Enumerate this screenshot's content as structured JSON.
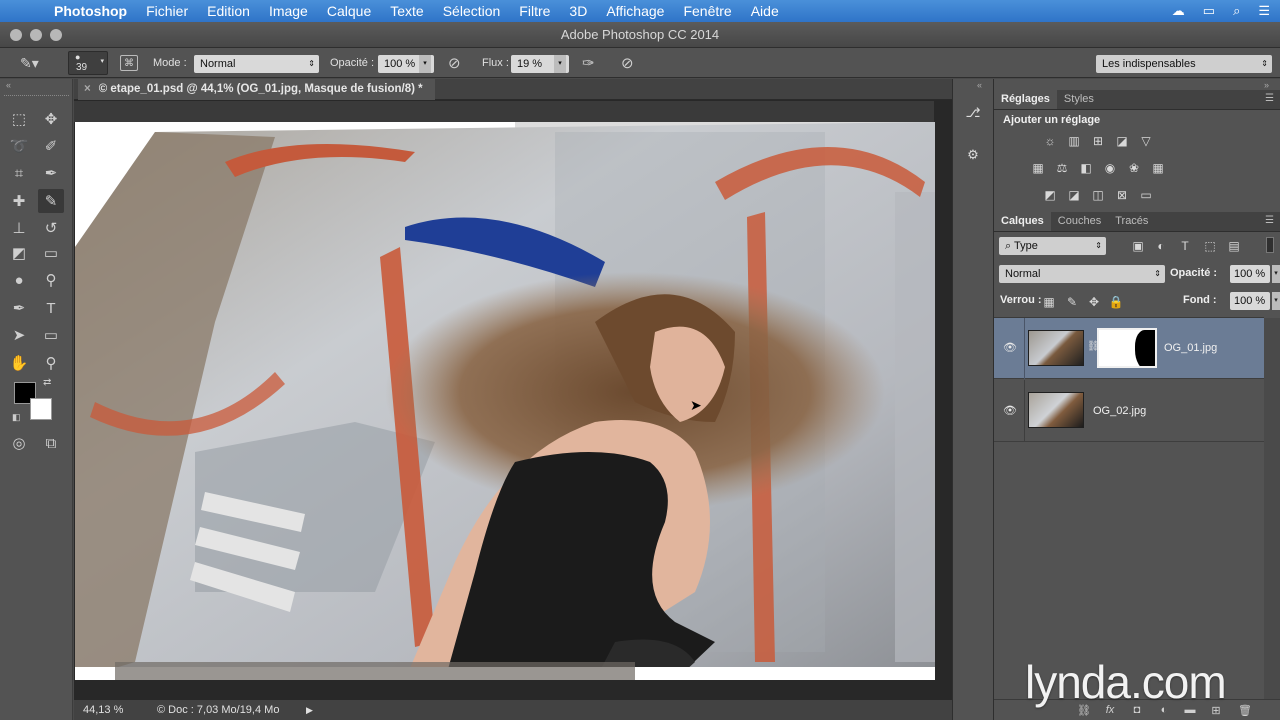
{
  "menubar": {
    "app": "Photoshop",
    "items": [
      "Fichier",
      "Edition",
      "Image",
      "Calque",
      "Texte",
      "Sélection",
      "Filtre",
      "3D",
      "Affichage",
      "Fenêtre",
      "Aide"
    ]
  },
  "window": {
    "title": "Adobe Photoshop CC 2014"
  },
  "options": {
    "brush_size": "39",
    "mode_label": "Mode :",
    "mode_value": "Normal",
    "opacity_label": "Opacité :",
    "opacity_value": "100 %",
    "flow_label": "Flux :",
    "flow_value": "19 %",
    "workspace": "Les indispensables"
  },
  "document": {
    "tab_title": "© etape_01.psd @ 44,1% (OG_01.jpg, Masque de fusion/8) *",
    "zoom": "44,13 %",
    "doc_info": "© Doc : 7,03 Mo/19,4 Mo"
  },
  "adjustments": {
    "tabs": [
      "Réglages",
      "Styles"
    ],
    "add_label": "Ajouter un réglage"
  },
  "layers_panel": {
    "tabs": [
      "Calques",
      "Couches",
      "Tracés"
    ],
    "filter_value": "Type",
    "blend_mode": "Normal",
    "opacity_label": "Opacité :",
    "opacity_value": "100 %",
    "lock_label": "Verrou :",
    "fill_label": "Fond :",
    "fill_value": "100 %",
    "layers": [
      {
        "name": "OG_01.jpg",
        "selected": true,
        "has_mask": true
      },
      {
        "name": "OG_02.jpg",
        "selected": false,
        "has_mask": false
      }
    ]
  },
  "watermark": "lynda.com",
  "colors": {
    "menubar": "#2f74c8",
    "panel": "#535353",
    "selected_layer": "#6b7c95"
  }
}
